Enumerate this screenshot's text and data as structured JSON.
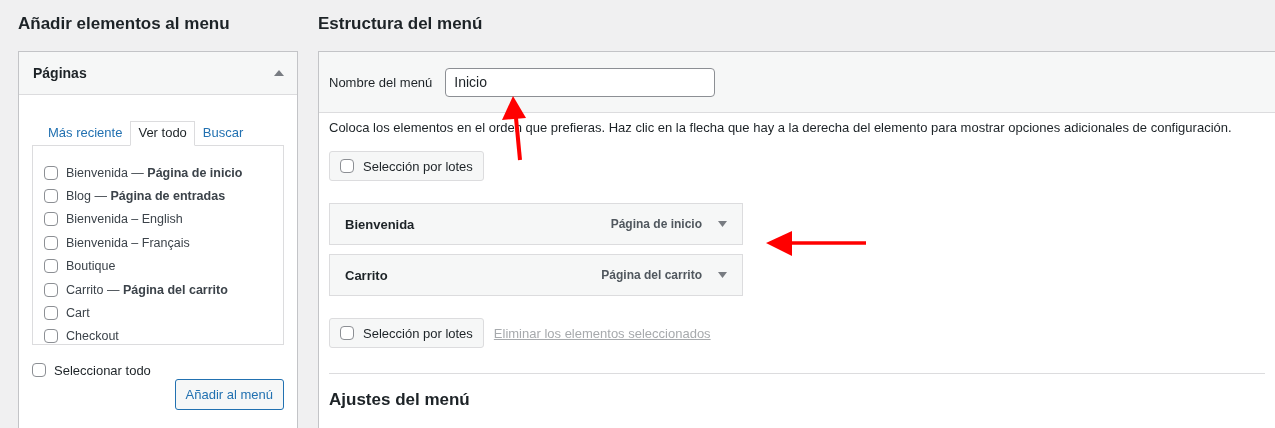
{
  "left": {
    "title": "Añadir elementos al menu",
    "panel": {
      "title": "Páginas",
      "expanded": true,
      "tabs": [
        {
          "label": "Más reciente",
          "selected": false
        },
        {
          "label": "Ver todo",
          "selected": true
        },
        {
          "label": "Buscar",
          "selected": false
        }
      ],
      "pages": [
        {
          "label": "Bienvenida — **Página de inicio**",
          "checked": false
        },
        {
          "label": "Blog — **Página de entradas**",
          "checked": false
        },
        {
          "label": "Bienvenida – English",
          "checked": false
        },
        {
          "label": "Bienvenida – Français",
          "checked": false
        },
        {
          "label": "Boutique",
          "checked": false
        },
        {
          "label": "Carrito — **Página del carrito**",
          "checked": false
        },
        {
          "label": "Cart",
          "checked": false
        },
        {
          "label": "Checkout",
          "checked": false
        }
      ],
      "select_all": {
        "label": "Seleccionar todo",
        "checked": false
      },
      "add_button": "Añadir al menú"
    }
  },
  "right": {
    "title": "Estructura del menú",
    "menu_name": {
      "label": "Nombre del menú",
      "value": "Inicio"
    },
    "instructions": "Coloca los elementos en el orden que prefieras. Haz clic en la flecha que hay a la derecha del elemento para mostrar opciones adicionales de configuración.",
    "bulk_top": {
      "label": "Selección por lotes",
      "checked": false
    },
    "items": [
      {
        "title": "Bienvenida",
        "type": "Página de inicio"
      },
      {
        "title": "Carrito",
        "type": "Página del carrito"
      }
    ],
    "bulk_bottom": {
      "label": "Selección por lotes",
      "checked": false
    },
    "delete_link": "Eliminar los elementos seleccionados",
    "settings_title": "Ajustes del menú"
  },
  "annotations": [
    {
      "kind": "arrow-up"
    },
    {
      "kind": "arrow-left"
    }
  ]
}
